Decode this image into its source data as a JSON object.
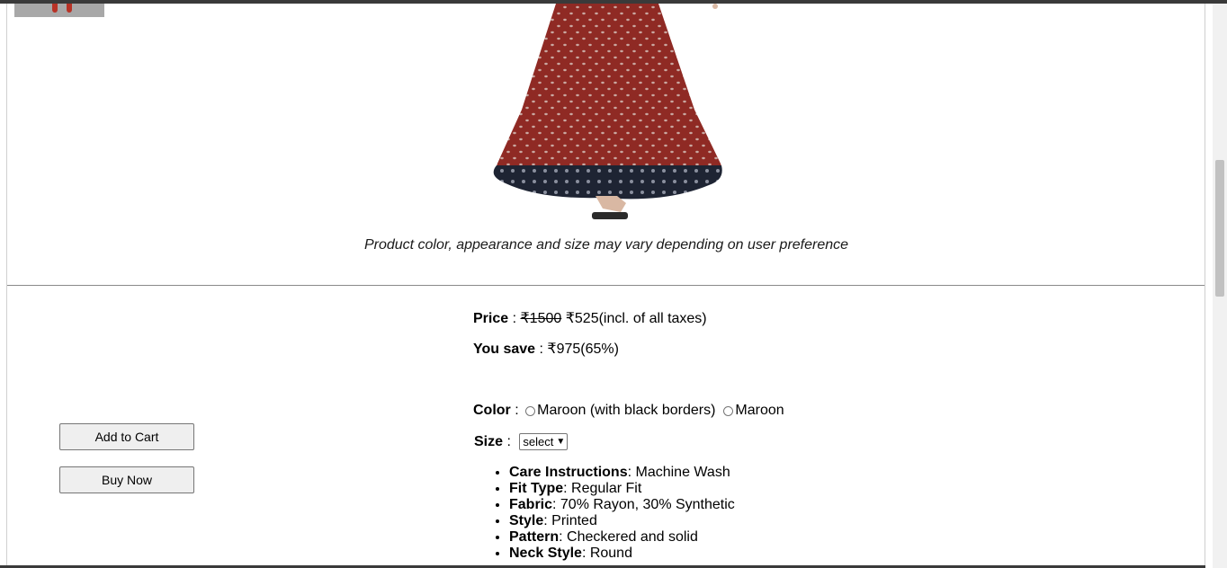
{
  "product": {
    "disclaimer": "Product color, appearance and size may vary depending on user preference",
    "price": {
      "label": "Price",
      "separator": " : ",
      "original": "₹1500",
      "current": "₹525",
      "note": "(incl. of all taxes)"
    },
    "save": {
      "label": "You save",
      "separator": " : ",
      "value": "₹975(65%)"
    },
    "color": {
      "label": "Color",
      "separator": " : ",
      "options": [
        "Maroon (with black borders)",
        "Maroon"
      ]
    },
    "size": {
      "label": "Size",
      "separator": " : ",
      "selected": "select"
    },
    "details": [
      {
        "key": "Care Instructions",
        "value": ": Machine Wash"
      },
      {
        "key": "Fit Type",
        "value": ": Regular Fit"
      },
      {
        "key": "Fabric",
        "value": ": 70% Rayon, 30% Synthetic"
      },
      {
        "key": "Style",
        "value": ": Printed"
      },
      {
        "key": "Pattern",
        "value": ": Checkered and solid"
      },
      {
        "key": "Neck Style",
        "value": ": Round"
      }
    ]
  },
  "actions": {
    "add_to_cart": "Add to Cart",
    "buy_now": "Buy Now"
  },
  "colors": {
    "skirt": "#8f2a24",
    "border": "#1e2433"
  },
  "icons": {
    "select_chevron": "chevron-down-icon"
  }
}
